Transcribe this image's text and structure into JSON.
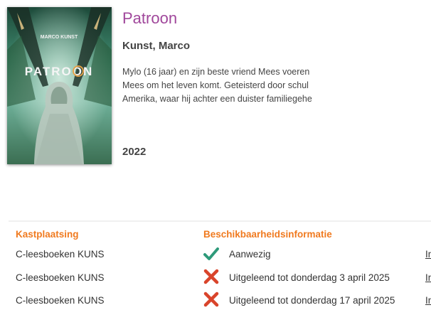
{
  "book": {
    "cover_author": "MARCO KUNST",
    "cover_title": "PATROON",
    "title": "Patroon",
    "author": "Kunst, Marco",
    "summary_lines": [
      "Mylo (16 jaar) en zijn beste vriend Mees voeren",
      "Mees om het leven komt. Geteisterd door schul",
      "Amerika, waar hij achter een duister familiegehe"
    ],
    "year": "2022"
  },
  "availability": {
    "headers": {
      "shelf": "Kastplaatsing",
      "status": "Beschikbaarheidsinformatie"
    },
    "rows": [
      {
        "shelf": "C-leesboeken KUNS",
        "status_icon": "check-icon",
        "status": "Aanwezig",
        "link": "In"
      },
      {
        "shelf": "C-leesboeken KUNS",
        "status_icon": "cross-icon",
        "status": "Uitgeleend tot donderdag 3 april 2025",
        "link": "In"
      },
      {
        "shelf": "C-leesboeken KUNS",
        "status_icon": "cross-icon",
        "status": "Uitgeleend tot donderdag 17 april 2025",
        "link": "In"
      }
    ]
  },
  "colors": {
    "title": "#a0479b",
    "header": "#f07a1f",
    "check": "#2e9a7a",
    "cross": "#d9442b"
  }
}
